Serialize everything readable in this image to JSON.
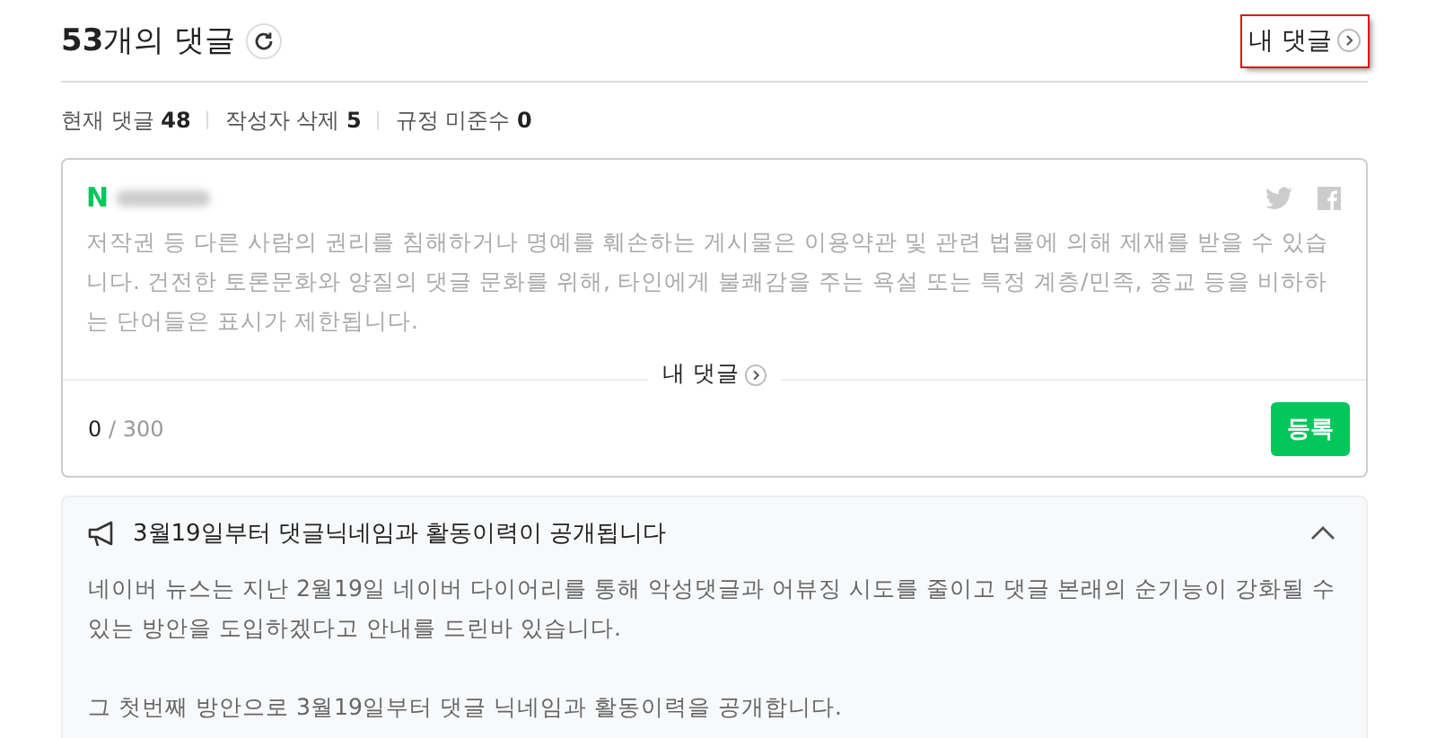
{
  "header": {
    "count": "53",
    "title_suffix": "개의 댓글",
    "my_comments_link": {
      "label": "내 댓글",
      "highlighted": true
    }
  },
  "stats": [
    {
      "label": "현재 댓글",
      "value": "48"
    },
    {
      "label": "작성자 삭제",
      "value": "5"
    },
    {
      "label": "규정 미준수",
      "value": "0"
    }
  ],
  "comment_box": {
    "logo": "N",
    "notice": "저작권 등 다른 사람의 권리를 침해하거나 명예를 훼손하는 게시물은 이용약관 및 관련 법률에 의해 제재를 받을 수 있습니다. 건전한 토론문화와 양질의 댓글 문화를 위해, 타인에게 불쾌감을 주는 욕설 또는 특정 계층/민족, 종교 등을 비하하는 단어들은 표시가 제한됩니다.",
    "my_comments_link": "내 댓글",
    "char_count": "0",
    "char_limit": "/ 300",
    "submit": "등록"
  },
  "announcement": {
    "title": "3월19일부터 댓글닉네임과 활동이력이 공개됩니다",
    "expanded": true,
    "paragraphs": [
      "네이버 뉴스는 지난 2월19일 네이버 다이어리를 통해 악성댓글과 어뷰징 시도를 줄이고 댓글 본래의 순기능이 강화될 수 있는 방안을 도입하겠다고 안내를 드린바 있습니다.",
      "그 첫번째 방안으로 3월19일부터 댓글 닉네임과 활동이력을 공개합니다."
    ]
  }
}
